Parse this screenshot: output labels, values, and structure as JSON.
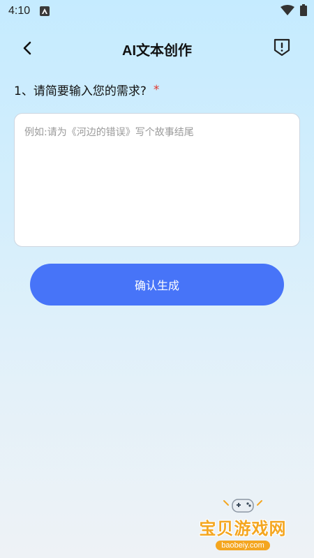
{
  "status_bar": {
    "time": "4:10"
  },
  "header": {
    "title": "AI文本创作",
    "back_icon": "chevron-left-icon",
    "report_icon": "shield-alert-icon"
  },
  "form": {
    "question_label": "1、请简要输入您的需求?",
    "required_mark": "*",
    "requirement_placeholder": "例如:请为《河边的错误》写个故事结尾",
    "requirement_value": ""
  },
  "actions": {
    "confirm_label": "确认生成"
  },
  "watermark": {
    "name": "宝贝游戏网",
    "url": "baobeiy.com"
  },
  "colors": {
    "accent": "#4774f8",
    "required": "#e0352b",
    "watermark": "#f4a620"
  }
}
